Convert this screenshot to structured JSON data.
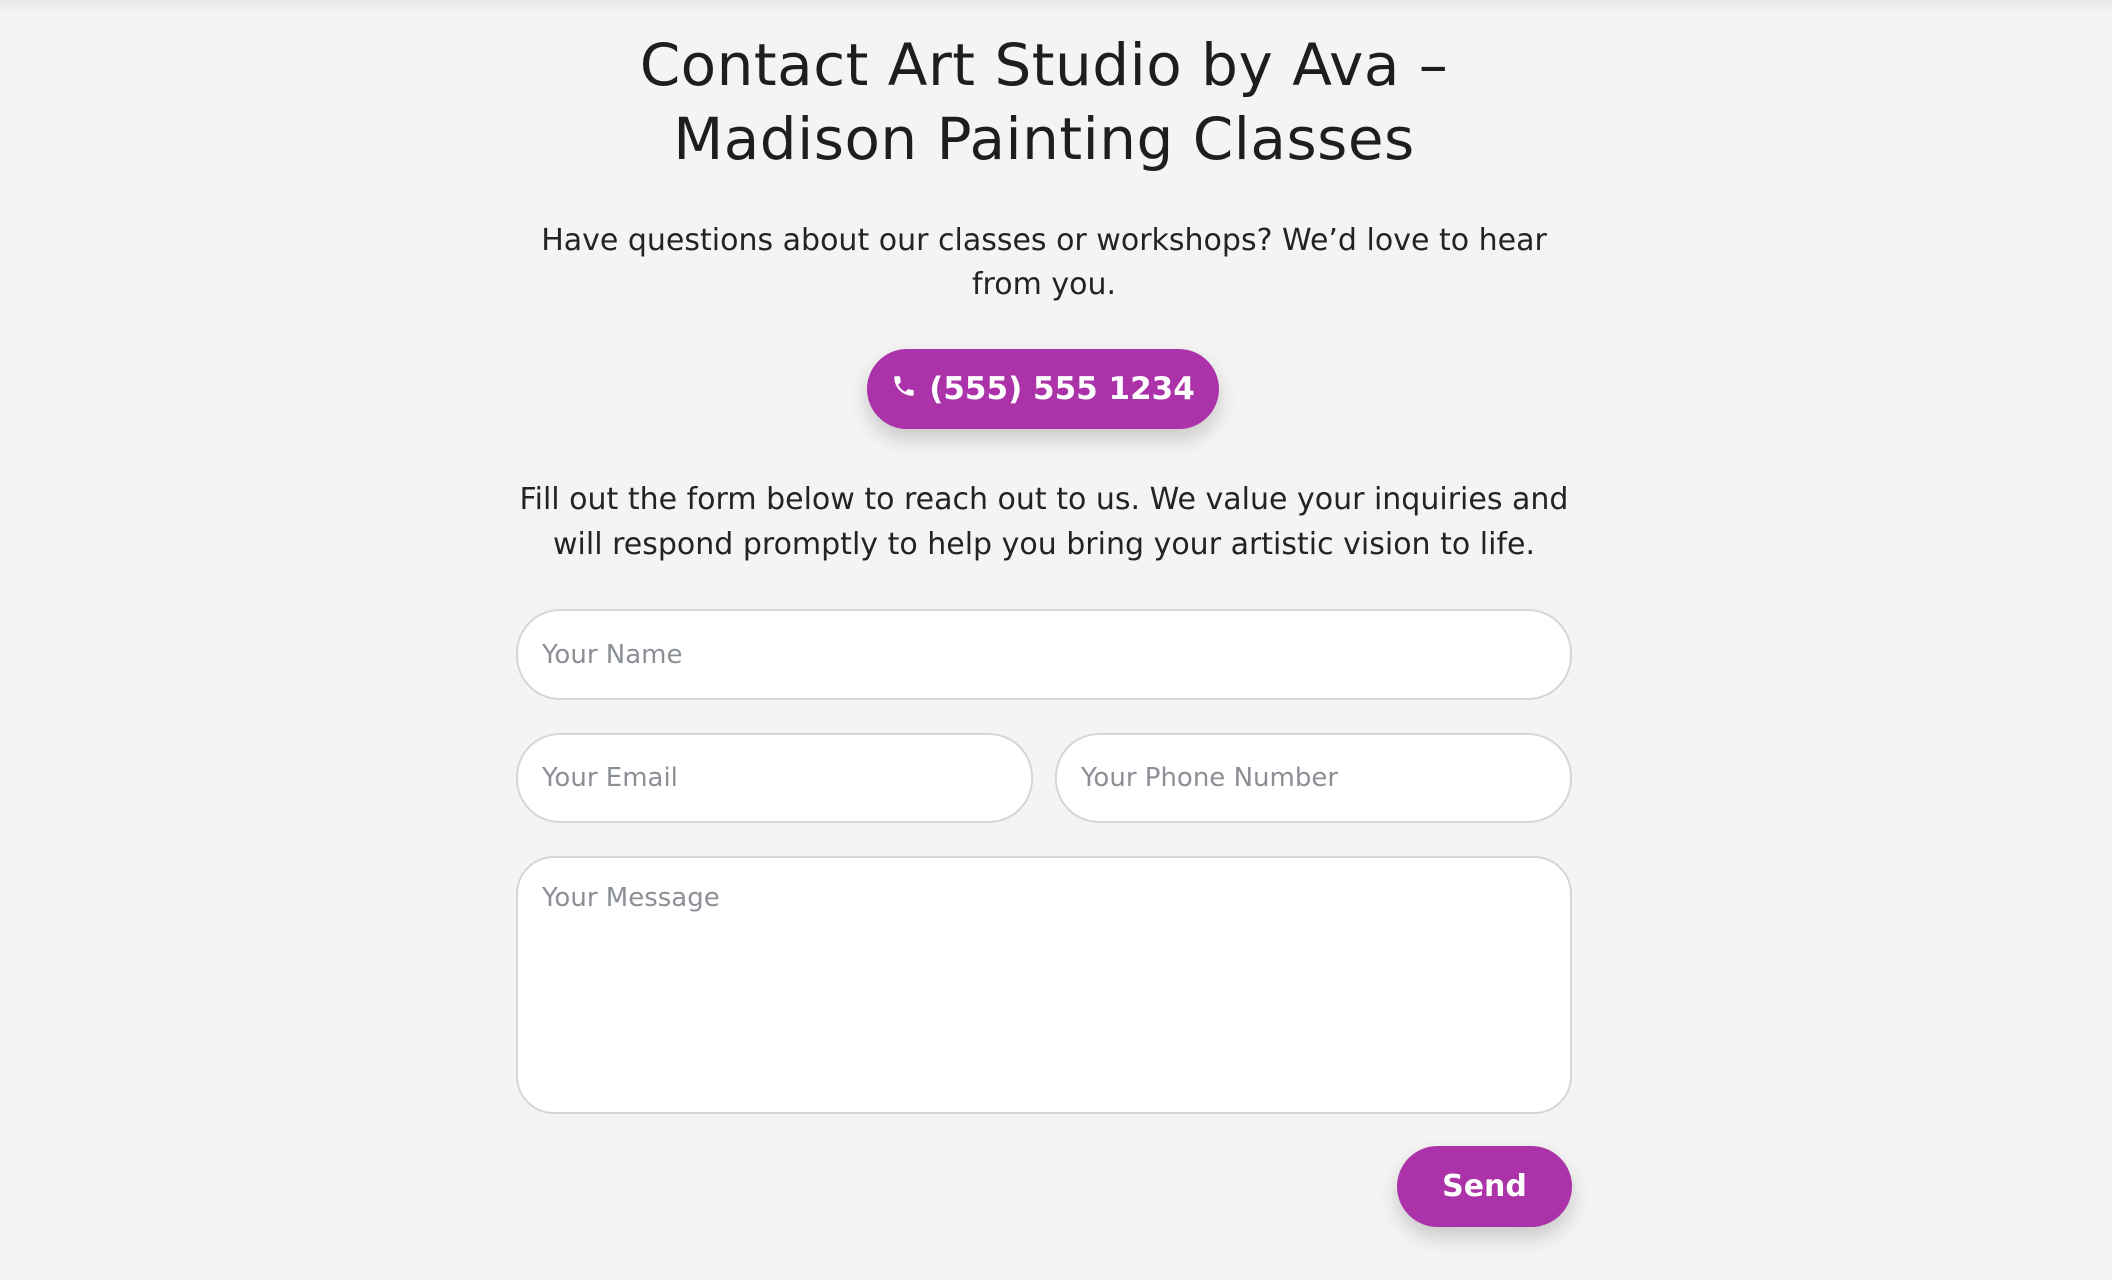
{
  "header": {
    "title_line1": "Contact Art Studio by Ava –",
    "title_line2": "Madison Painting Classes"
  },
  "intro": {
    "text": "Have questions about our classes or workshops? We’d love to hear from you."
  },
  "phone_button": {
    "icon": "phone-icon",
    "label": "(555) 555 1234"
  },
  "form_intro": {
    "text": "Fill out the form below to reach out to us. We value your inquiries and will respond promptly to help you bring your artistic vision to life."
  },
  "form": {
    "name_placeholder": "Your Name",
    "email_placeholder": "Your Email",
    "phone_placeholder": "Your Phone Number",
    "message_placeholder": "Your Message",
    "send_label": "Send"
  },
  "colors": {
    "accent": "#ab32a8",
    "background": "#f4f4f4",
    "field_border": "#d6d6d8"
  }
}
